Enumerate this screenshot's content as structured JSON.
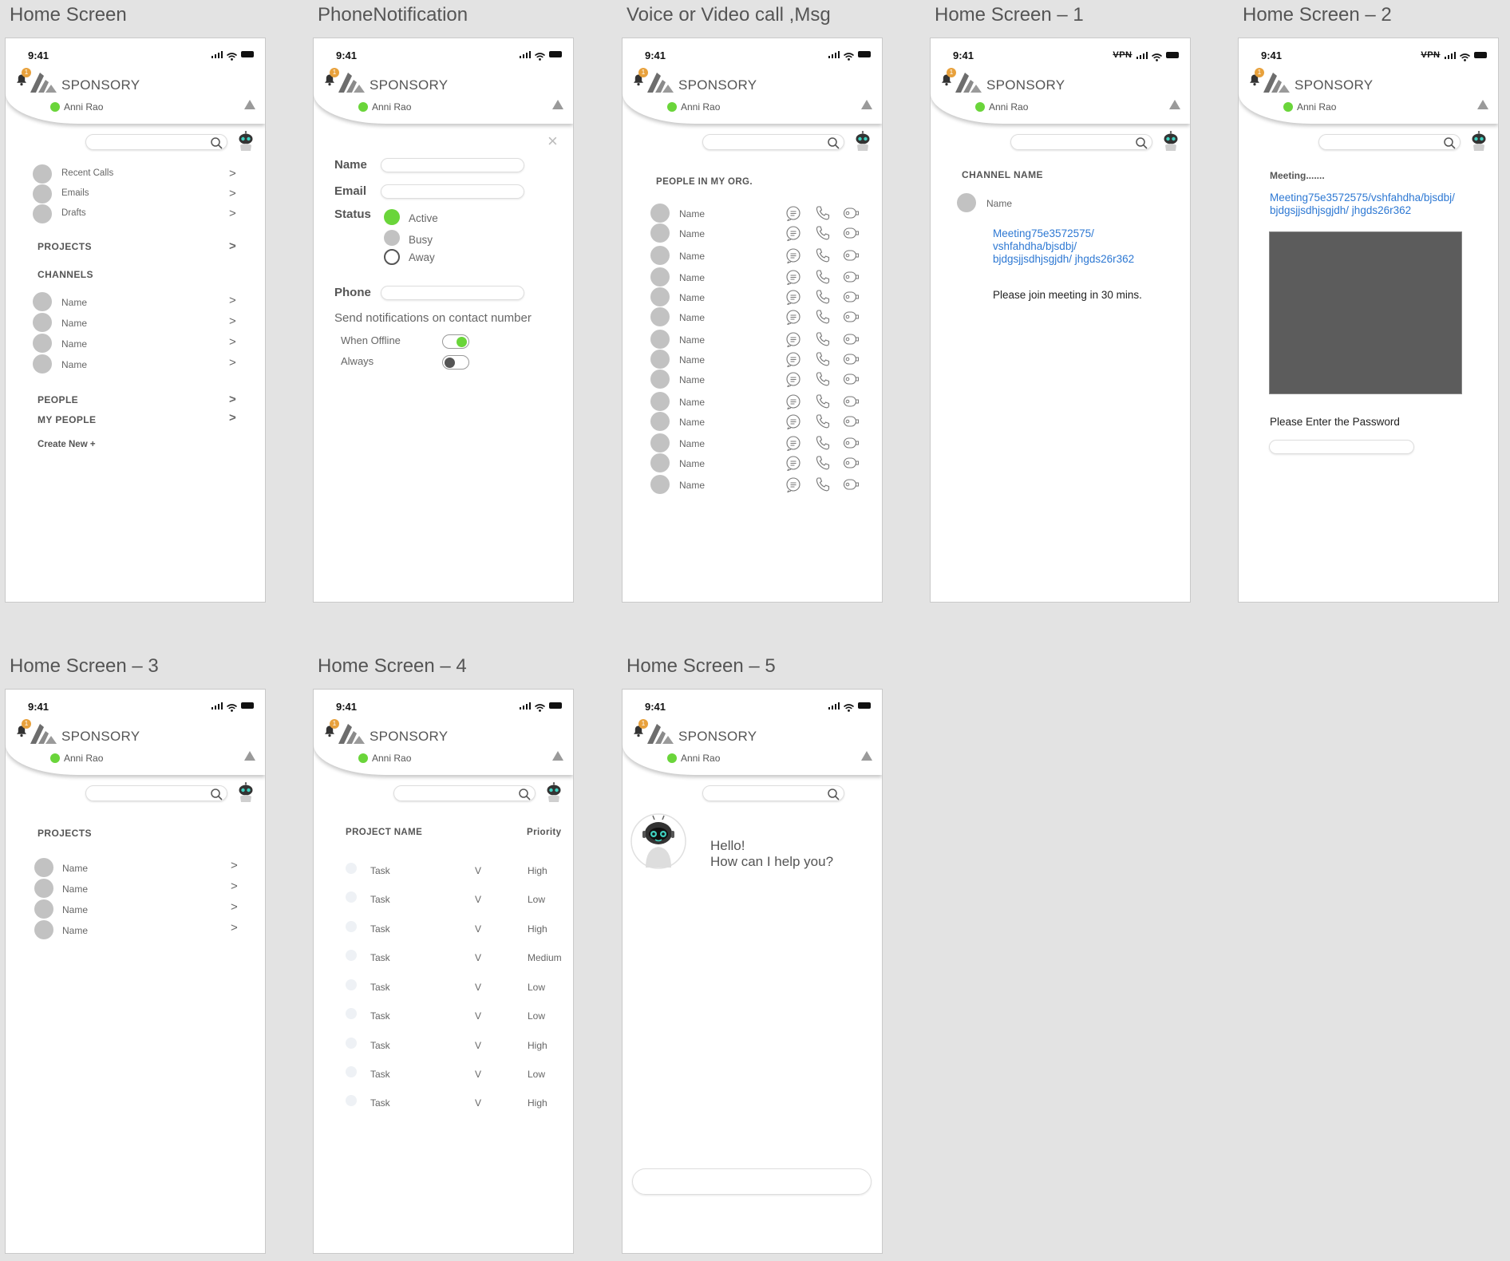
{
  "common": {
    "time": "9:41",
    "vpn": "VPN",
    "brand": "SPONSORY",
    "user": "Anni Rao",
    "badge": "1"
  },
  "artboards": {
    "home": "Home Screen",
    "phone": "PhoneNotification",
    "voice": "Voice or Video call ,Msg",
    "home1": "Home Screen – 1",
    "home2": "Home Screen – 2",
    "home3": "Home Screen – 3",
    "home4": "Home Screen – 4",
    "home5": "Home Screen – 5"
  },
  "home": {
    "quick": [
      "Recent Calls",
      "Emails",
      "Drafts"
    ],
    "projects": "PROJECTS",
    "channels": "CHANNELS",
    "channel_items": [
      "Name",
      "Name",
      "Name",
      "Name"
    ],
    "people": "PEOPLE",
    "my_people": "MY PEOPLE",
    "create_new": "Create New +",
    "chevron": ">"
  },
  "phone": {
    "name_label": "Name",
    "email_label": "Email",
    "status_label": "Status",
    "status_options": [
      "Active",
      "Busy",
      "Away"
    ],
    "phone_label": "Phone",
    "send_text": "Send notifications on contact number",
    "when_offline": "When Offline",
    "always": "Always",
    "close": "×"
  },
  "voice": {
    "heading": "PEOPLE IN MY ORG.",
    "people": [
      "Name",
      "Name",
      "Name",
      "Name",
      "Name",
      "Name",
      "Name",
      "Name",
      "Name",
      "Name",
      "Name",
      "Name",
      "Name",
      "Name"
    ]
  },
  "home1": {
    "channel_name": "CHANNEL NAME",
    "member": "Name",
    "link": [
      "Meeting75e3572575/",
      "vshfahdha/bjsdbj/",
      "bjdgsjjsdhjsgjdh/ jhgds26r362"
    ],
    "message": "Please join meeting in 30 mins."
  },
  "home2": {
    "title": "Meeting.......",
    "link": [
      "Meeting75e3572575/vshfahdha/bjsdbj/",
      "bjdgsjjsdhjsgjdh/ jhgds26r362"
    ],
    "password_label": "Please Enter the Password"
  },
  "home3": {
    "heading": "PROJECTS",
    "items": [
      "Name",
      "Name",
      "Name",
      "Name"
    ]
  },
  "home4": {
    "project_name": "PROJECT NAME",
    "priority": "Priority",
    "v": "V",
    "tasks": [
      {
        "name": "Task",
        "priority": "High"
      },
      {
        "name": "Task",
        "priority": "Low"
      },
      {
        "name": "Task",
        "priority": "High"
      },
      {
        "name": "Task",
        "priority": "Medium"
      },
      {
        "name": "Task",
        "priority": "Low"
      },
      {
        "name": "Task",
        "priority": "Low"
      },
      {
        "name": "Task",
        "priority": "High"
      },
      {
        "name": "Task",
        "priority": "Low"
      },
      {
        "name": "Task",
        "priority": "High"
      }
    ]
  },
  "home5": {
    "greeting1": "Hello!",
    "greeting2": "How can I help you?"
  },
  "colors": {
    "status_active": "#6ad53a",
    "badge": "#e8a13c",
    "link": "#2d78d3"
  }
}
